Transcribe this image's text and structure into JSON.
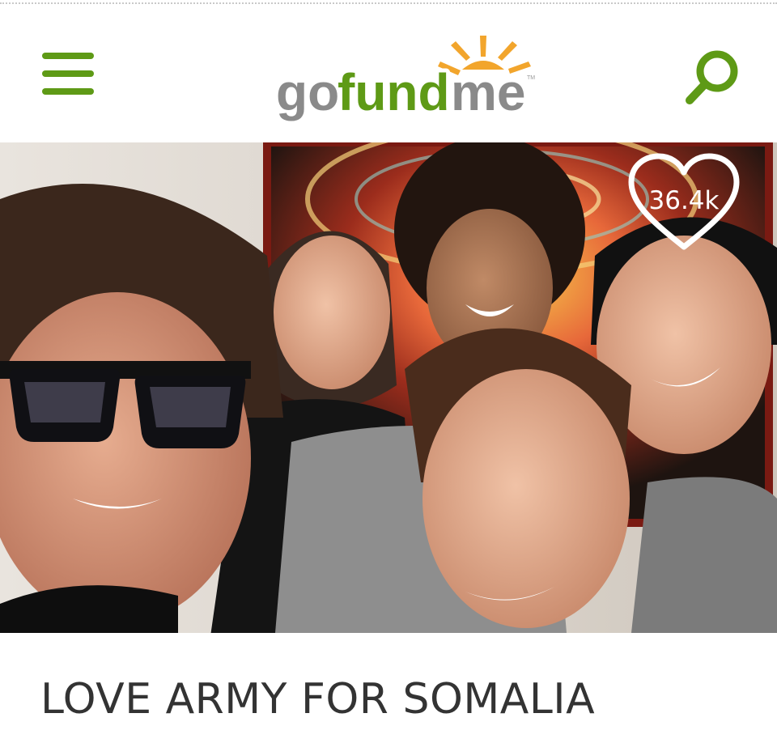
{
  "header": {
    "logo": {
      "word_go": "go",
      "word_fund": "fund",
      "word_me": "me",
      "tm": "TM"
    },
    "menu_icon": "hamburger-menu-icon",
    "search_icon": "search-icon"
  },
  "campaign": {
    "likes": "36.4k",
    "title": "LOVE ARMY FOR SOMALIA"
  },
  "colors": {
    "brand_green": "#5e9a16",
    "logo_grey": "#8a8a8a",
    "logo_orange": "#f2a52c",
    "title_text": "#333333"
  }
}
